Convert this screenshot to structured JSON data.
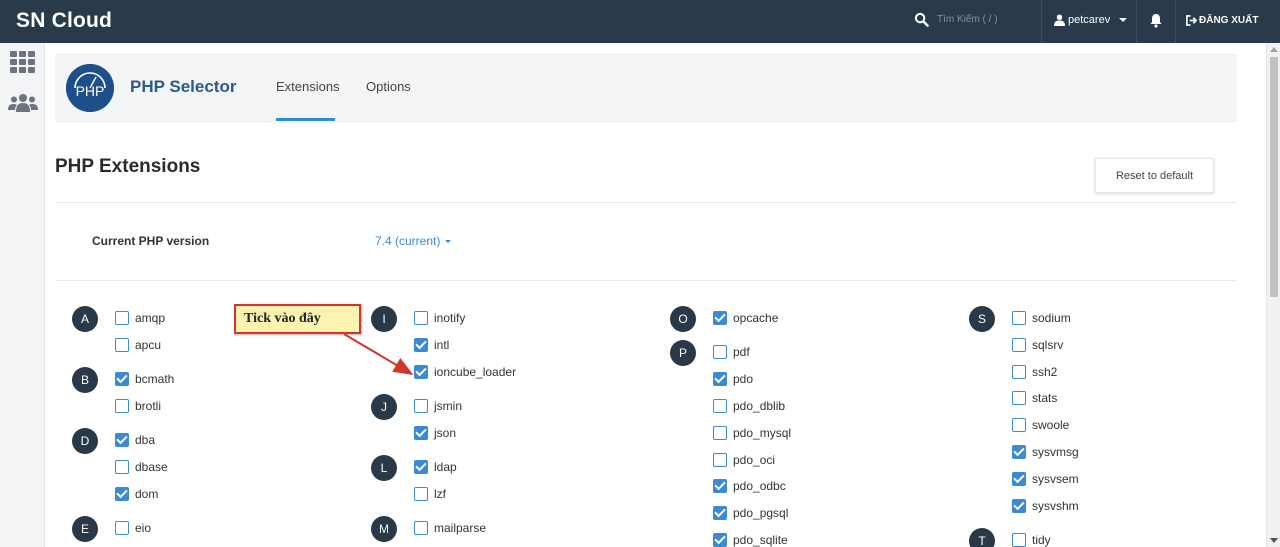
{
  "topbar": {
    "brand": "SN Cloud",
    "search_placeholder": "Tìm Kiếm ( / )",
    "username": "petcarev",
    "logout_label": "ĐĂNG XUẤT"
  },
  "plugin": {
    "title": "PHP Selector",
    "logo_text": "PHP",
    "tabs": [
      "Extensions",
      "Options"
    ],
    "active_tab": "Extensions"
  },
  "page": {
    "title": "PHP Extensions",
    "reset_label": "Reset to default",
    "version_label": "Current PHP version",
    "version_value": "7.4 (current)"
  },
  "annotation": {
    "text": "Tick vào đây",
    "color": "#d2342e"
  },
  "colors": {
    "topbar": "#293a4a",
    "accent": "#3a8ad6",
    "letter_badge": "#2a3947"
  },
  "extensions": [
    {
      "letter": "A",
      "items": [
        {
          "name": "amqp",
          "checked": false
        },
        {
          "name": "apcu",
          "checked": false
        }
      ]
    },
    {
      "letter": "B",
      "items": [
        {
          "name": "bcmath",
          "checked": true
        },
        {
          "name": "brotli",
          "checked": false
        }
      ]
    },
    {
      "letter": "D",
      "items": [
        {
          "name": "dba",
          "checked": true
        },
        {
          "name": "dbase",
          "checked": false
        },
        {
          "name": "dom",
          "checked": true
        }
      ]
    },
    {
      "letter": "E",
      "items": [
        {
          "name": "eio",
          "checked": false
        }
      ]
    },
    {
      "letter": "I",
      "items": [
        {
          "name": "inotify",
          "checked": false
        },
        {
          "name": "intl",
          "checked": true
        },
        {
          "name": "ioncube_loader",
          "checked": true
        }
      ]
    },
    {
      "letter": "J",
      "items": [
        {
          "name": "jsmin",
          "checked": false
        },
        {
          "name": "json",
          "checked": true
        }
      ]
    },
    {
      "letter": "L",
      "items": [
        {
          "name": "ldap",
          "checked": true
        },
        {
          "name": "lzf",
          "checked": false
        }
      ]
    },
    {
      "letter": "M",
      "items": [
        {
          "name": "mailparse",
          "checked": false
        }
      ]
    },
    {
      "letter": "O",
      "items": [
        {
          "name": "opcache",
          "checked": true
        }
      ]
    },
    {
      "letter": "P",
      "items": [
        {
          "name": "pdf",
          "checked": false
        },
        {
          "name": "pdo",
          "checked": true
        },
        {
          "name": "pdo_dblib",
          "checked": false
        },
        {
          "name": "pdo_mysql",
          "checked": false
        },
        {
          "name": "pdo_oci",
          "checked": false
        },
        {
          "name": "pdo_odbc",
          "checked": true
        },
        {
          "name": "pdo_pgsql",
          "checked": true
        },
        {
          "name": "pdo_sqlite",
          "checked": true
        }
      ]
    },
    {
      "letter": "S",
      "items": [
        {
          "name": "sodium",
          "checked": false
        },
        {
          "name": "sqlsrv",
          "checked": false
        },
        {
          "name": "ssh2",
          "checked": false
        },
        {
          "name": "stats",
          "checked": false
        },
        {
          "name": "swoole",
          "checked": false
        },
        {
          "name": "sysvmsg",
          "checked": true
        },
        {
          "name": "sysvsem",
          "checked": true
        },
        {
          "name": "sysvshm",
          "checked": true
        }
      ]
    },
    {
      "letter": "T",
      "items": [
        {
          "name": "tidy",
          "checked": false
        }
      ]
    }
  ]
}
